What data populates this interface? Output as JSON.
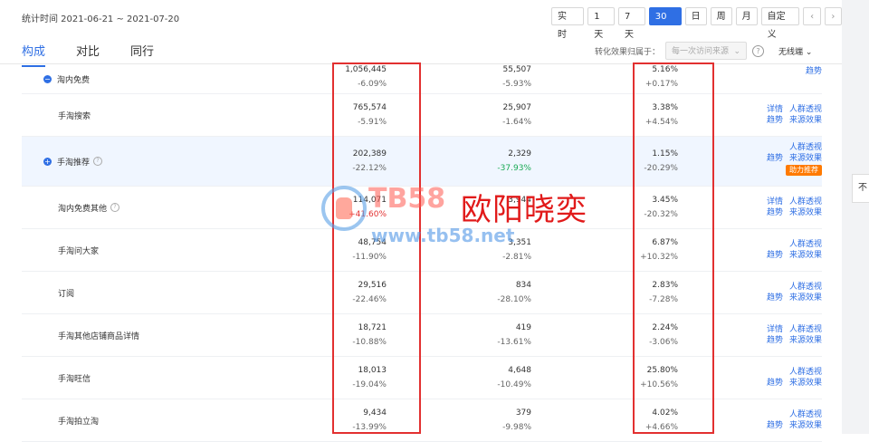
{
  "header": {
    "stat_time": "统计时间 2021-06-21 ~ 2021-07-20",
    "range_buttons": [
      "实 时",
      "1天",
      "7天",
      "30天",
      "日",
      "周",
      "月",
      "自定义"
    ],
    "active_range": "30天",
    "nav_prev": "‹",
    "nav_next": "›"
  },
  "tabs": [
    "构成",
    "对比",
    "同行"
  ],
  "attribution": {
    "label": "转化效果归属于：",
    "select_value": "每一次访问来源",
    "wireless_label": "无线端"
  },
  "rows": [
    {
      "name": "淘内免费",
      "expanded": true,
      "help": false,
      "v1": "1,056,445",
      "s1": "-6.09%",
      "v2": "55,507",
      "s2": "-5.93%",
      "v3": "5.16%",
      "s3": "+0.17%",
      "links_top": [],
      "links_bottom": [
        "趋势"
      ]
    },
    {
      "name": "手淘搜索",
      "v1": "765,574",
      "s1": "-5.91%",
      "v2": "25,907",
      "s2": "-1.64%",
      "v3": "3.38%",
      "s3": "+4.54%",
      "links_top": [
        "详情",
        "人群透视"
      ],
      "links_bottom": [
        "趋势",
        "来源效果"
      ]
    },
    {
      "name": "手淘推荐",
      "expand_icon": true,
      "help": true,
      "v1": "202,389",
      "s1": "-22.12%",
      "v2": "2,329",
      "s2": "-37.93%",
      "s2_green": true,
      "v3": "1.15%",
      "s3": "-20.29%",
      "links_top": [
        "人群透视"
      ],
      "links_bottom": [
        "趋势",
        "来源效果"
      ],
      "badge": "助力推荐"
    },
    {
      "name": "淘内免费其他",
      "help": true,
      "v1": "114,071",
      "s1": "+41.60%",
      "v2": "3,944",
      "s2": "",
      "v3": "3.45%",
      "s3": "-20.32%",
      "links_top": [
        "详情",
        "人群透视"
      ],
      "links_bottom": [
        "趋势",
        "来源效果"
      ]
    },
    {
      "name": "手淘问大家",
      "v1": "48,754",
      "s1": "-11.90%",
      "v2": "3,351",
      "s2": "-2.81%",
      "v3": "6.87%",
      "s3": "+10.32%",
      "links_top": [
        "人群透视"
      ],
      "links_bottom": [
        "趋势",
        "来源效果"
      ]
    },
    {
      "name": "订阅",
      "v1": "29,516",
      "s1": "-22.46%",
      "v2": "834",
      "s2": "-28.10%",
      "v3": "2.83%",
      "s3": "-7.28%",
      "links_top": [
        "人群透视"
      ],
      "links_bottom": [
        "趋势",
        "来源效果"
      ]
    },
    {
      "name": "手淘其他店铺商品详情",
      "v1": "18,721",
      "s1": "-10.88%",
      "v2": "419",
      "s2": "-13.61%",
      "v3": "2.24%",
      "s3": "-3.06%",
      "links_top": [
        "详情",
        "人群透视"
      ],
      "links_bottom": [
        "趋势",
        "来源效果"
      ]
    },
    {
      "name": "手淘旺信",
      "v1": "18,013",
      "s1": "-19.04%",
      "v2": "4,648",
      "s2": "-10.49%",
      "v3": "25.80%",
      "s3": "+10.56%",
      "links_top": [
        "人群透视"
      ],
      "links_bottom": [
        "趋势",
        "来源效果"
      ]
    },
    {
      "name": "手淘拍立淘",
      "v1": "9,434",
      "s1": "-13.99%",
      "v2": "379",
      "s2": "-9.98%",
      "v3": "4.02%",
      "s3": "+4.66%",
      "links_top": [
        "人群透视"
      ],
      "links_bottom": [
        "趋势",
        "来源效果"
      ]
    }
  ],
  "side_button": "不",
  "watermark": {
    "brand": "TB58",
    "url": "www.tb58.net",
    "text": "欧阳晓奕"
  },
  "colors": {
    "accent": "#2f6fe4",
    "highlight_box": "#e23030",
    "badge": "#ff7a00"
  }
}
